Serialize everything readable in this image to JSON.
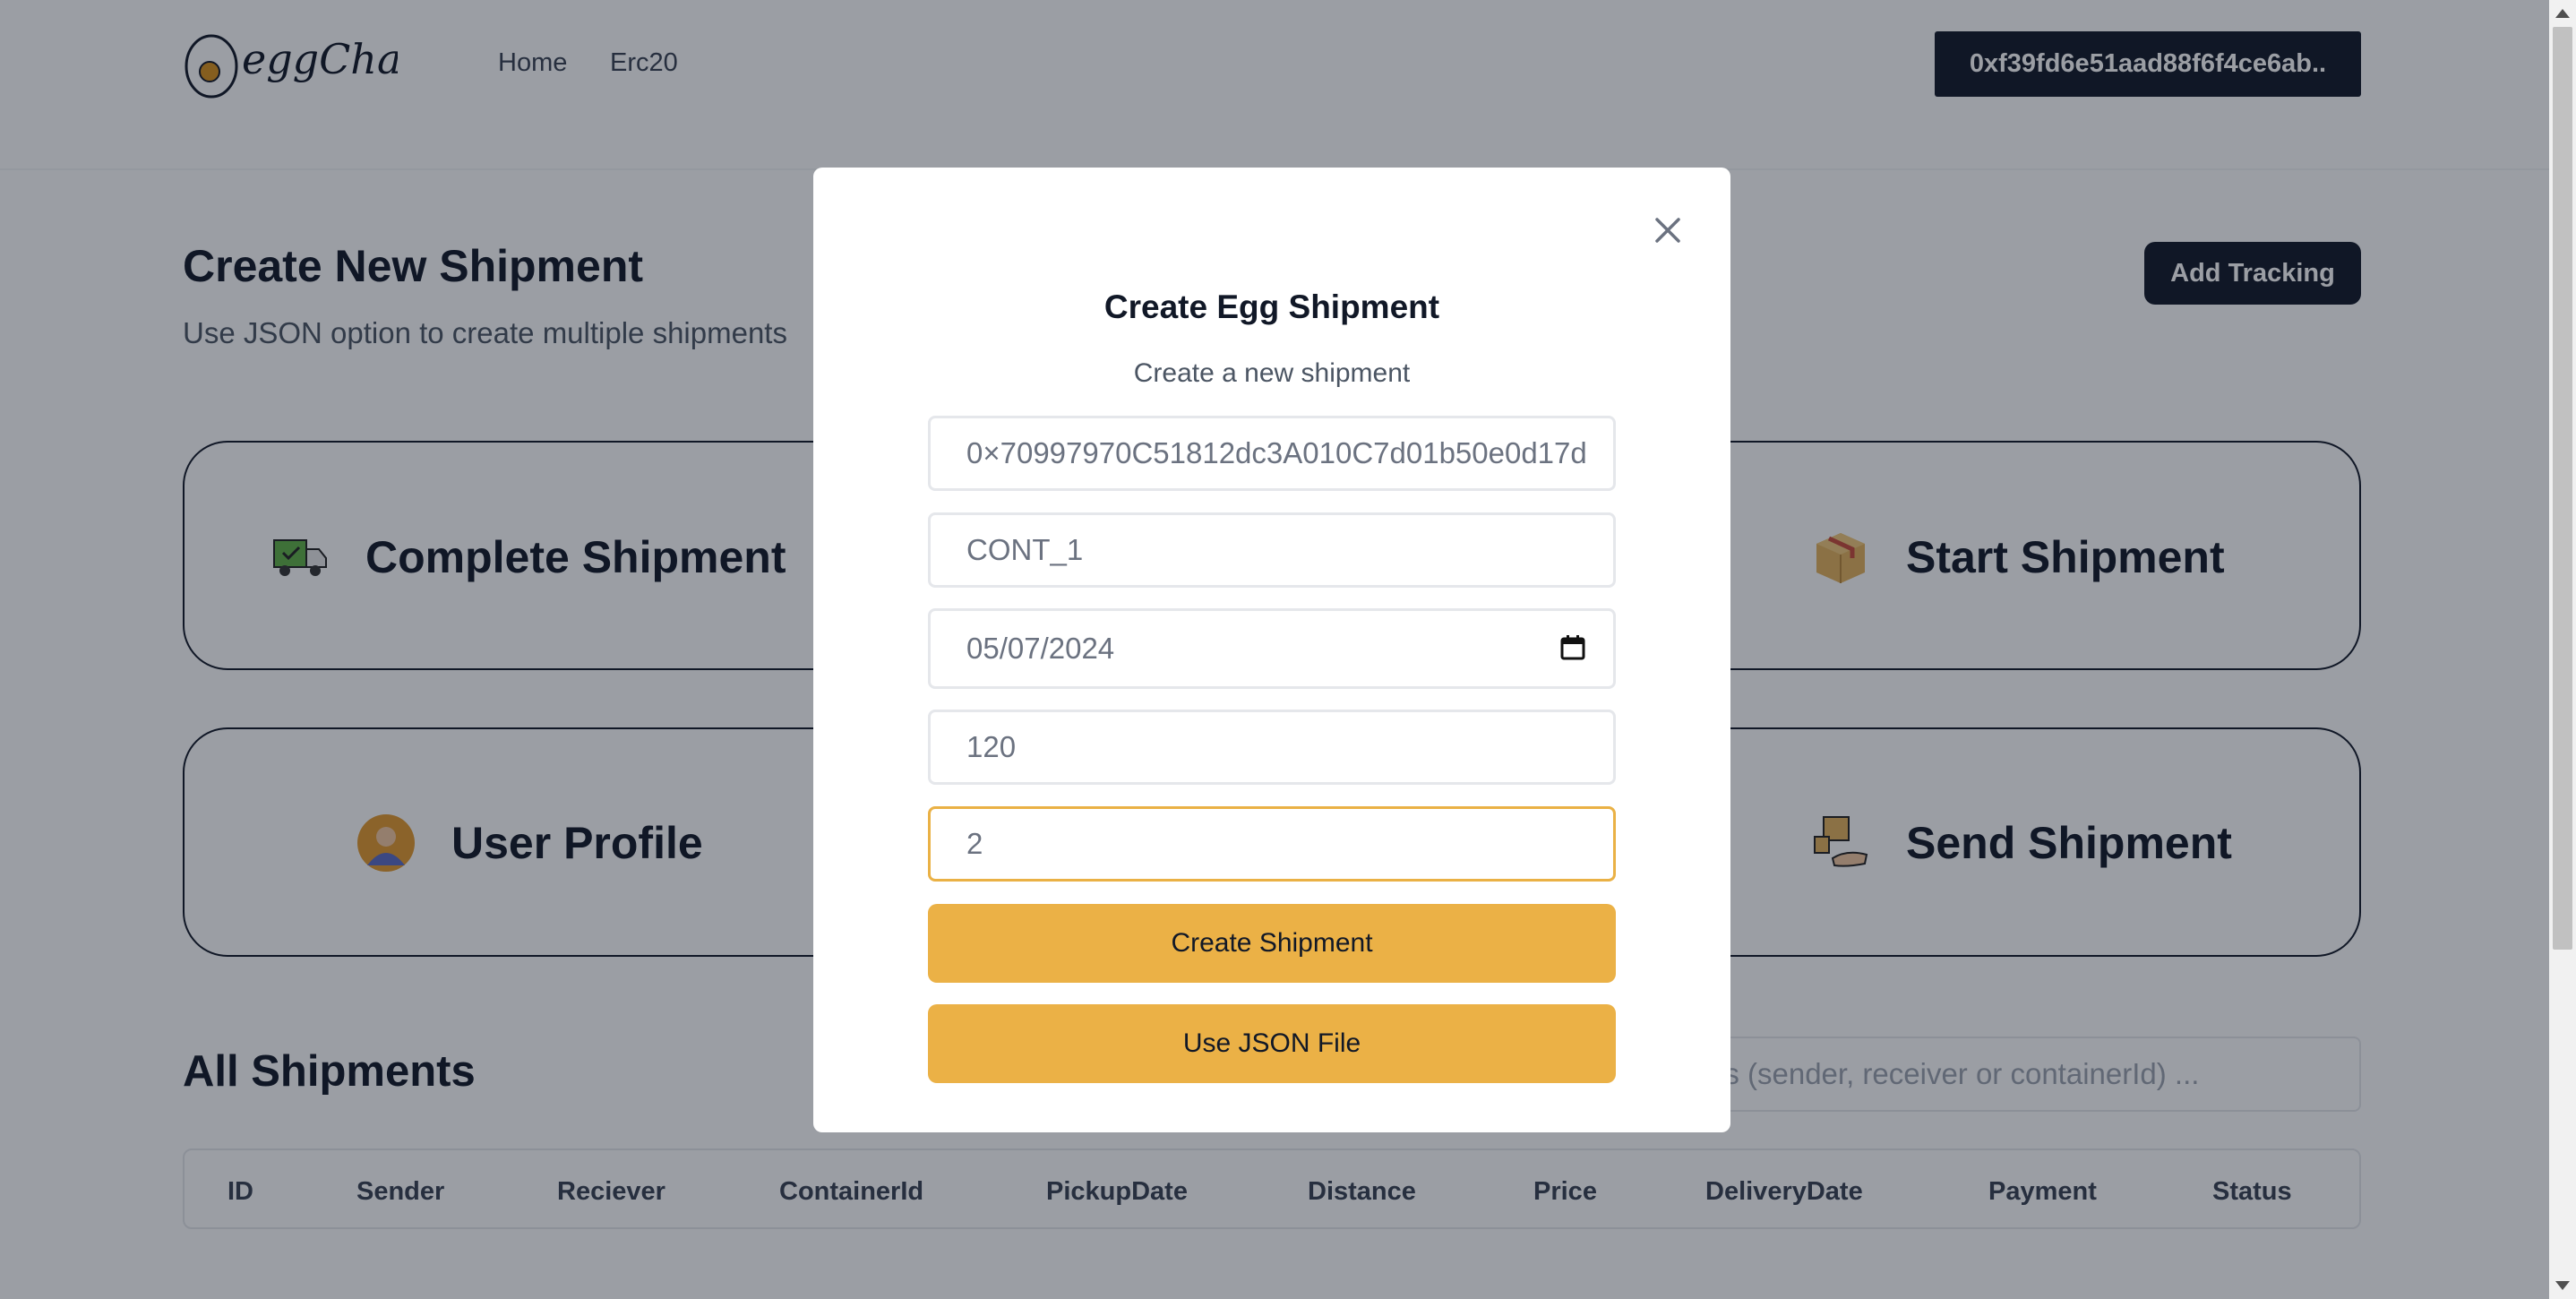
{
  "header": {
    "logo_text": "eggChain",
    "nav": [
      {
        "label": "Home"
      },
      {
        "label": "Erc20"
      }
    ],
    "wallet_address": "0xf39fd6e51aad88f6f4ce6ab.."
  },
  "main": {
    "title": "Create New Shipment",
    "subtitle": "Use JSON option to create multiple shipments",
    "add_tracking_label": "Add Tracking",
    "cards": [
      {
        "label": "Complete Shipment",
        "icon": "truck-icon"
      },
      {
        "label": "Start Shipment",
        "icon": "package-box-icon"
      },
      {
        "label": "User Profile",
        "icon": "user-avatar-icon"
      },
      {
        "label": "Send Shipment",
        "icon": "hand-delivery-icon"
      }
    ]
  },
  "shipments": {
    "title": "All Shipments",
    "search_placeholder": "ers (sender, receiver or containerId) ...",
    "columns": [
      "ID",
      "Sender",
      "Reciever",
      "ContainerId",
      "PickupDate",
      "Distance",
      "Price",
      "DeliveryDate",
      "Payment",
      "Status"
    ]
  },
  "modal": {
    "title": "Create Egg Shipment",
    "subtitle": "Create a new shipment",
    "fields": {
      "receiver": "0×70997970C51812dc3A010C7d01b50e0d17d",
      "container_id": "CONT_1",
      "pickup_date": "05/07/2024",
      "distance": "120",
      "price": "2"
    },
    "create_button": "Create Shipment",
    "json_button": "Use JSON File"
  },
  "colors": {
    "accent": "#ebb146",
    "dark": "#111827",
    "focus_border": "#eab145"
  }
}
